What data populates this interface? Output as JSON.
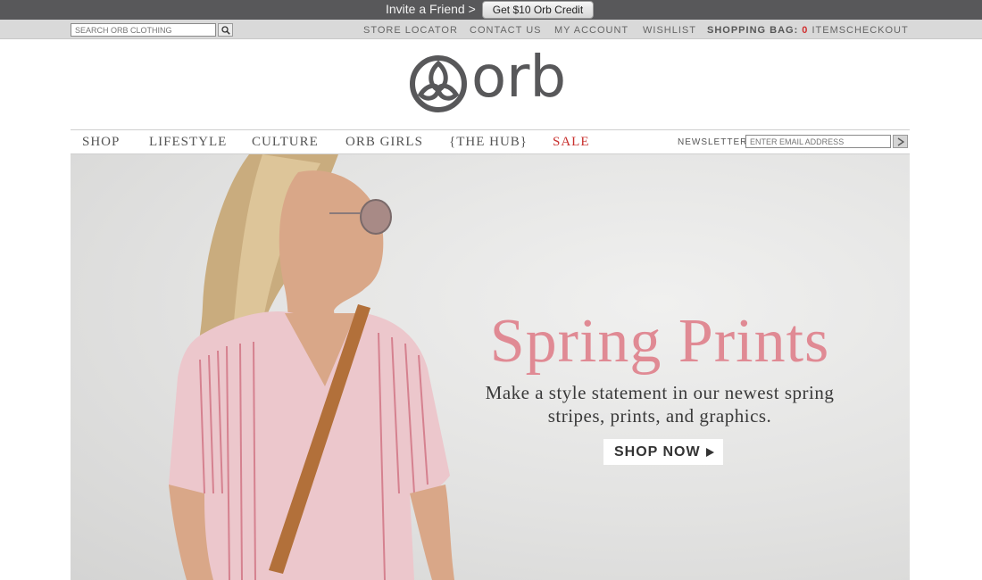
{
  "invite_bar": {
    "text": "Invite a Friend >",
    "button_label": "Get $10 Orb Credit"
  },
  "utility": {
    "search_placeholder": "SEARCH ORB CLOTHING",
    "links": {
      "store_locator": "STORE LOCATOR",
      "contact_us": "CONTACT US",
      "my_account": "MY ACCOUNT",
      "wishlist": "WISHLIST",
      "checkout": "CHECKOUT"
    },
    "bag": {
      "label": "SHOPPING BAG:",
      "count": "0",
      "suffix": "ITEMS"
    }
  },
  "logo": {
    "text": "orb"
  },
  "nav": {
    "items": [
      "SHOP",
      "LIFESTYLE",
      "CULTURE",
      "ORB GIRLS",
      "{THE HUB}",
      "SALE"
    ],
    "newsletter_label": "NEWSLETTER",
    "newsletter_placeholder": "ENTER EMAIL ADDRESS"
  },
  "hero": {
    "headline": "Spring Prints",
    "subline_1": "Make a style statement in our newest spring",
    "subline_2": "stripes, prints, and graphics.",
    "cta": "SHOP NOW"
  },
  "colors": {
    "invite_bar": "#58585a",
    "utility_bar": "#d9d9d9",
    "headline_pink": "#e08a94",
    "sale_red": "#c8302e",
    "bag_count_red": "#d03030"
  },
  "icons": {
    "search": "magnifier-icon",
    "newsletter_submit": "arrow-right-icon",
    "cta_arrow": "play-triangle-icon"
  }
}
